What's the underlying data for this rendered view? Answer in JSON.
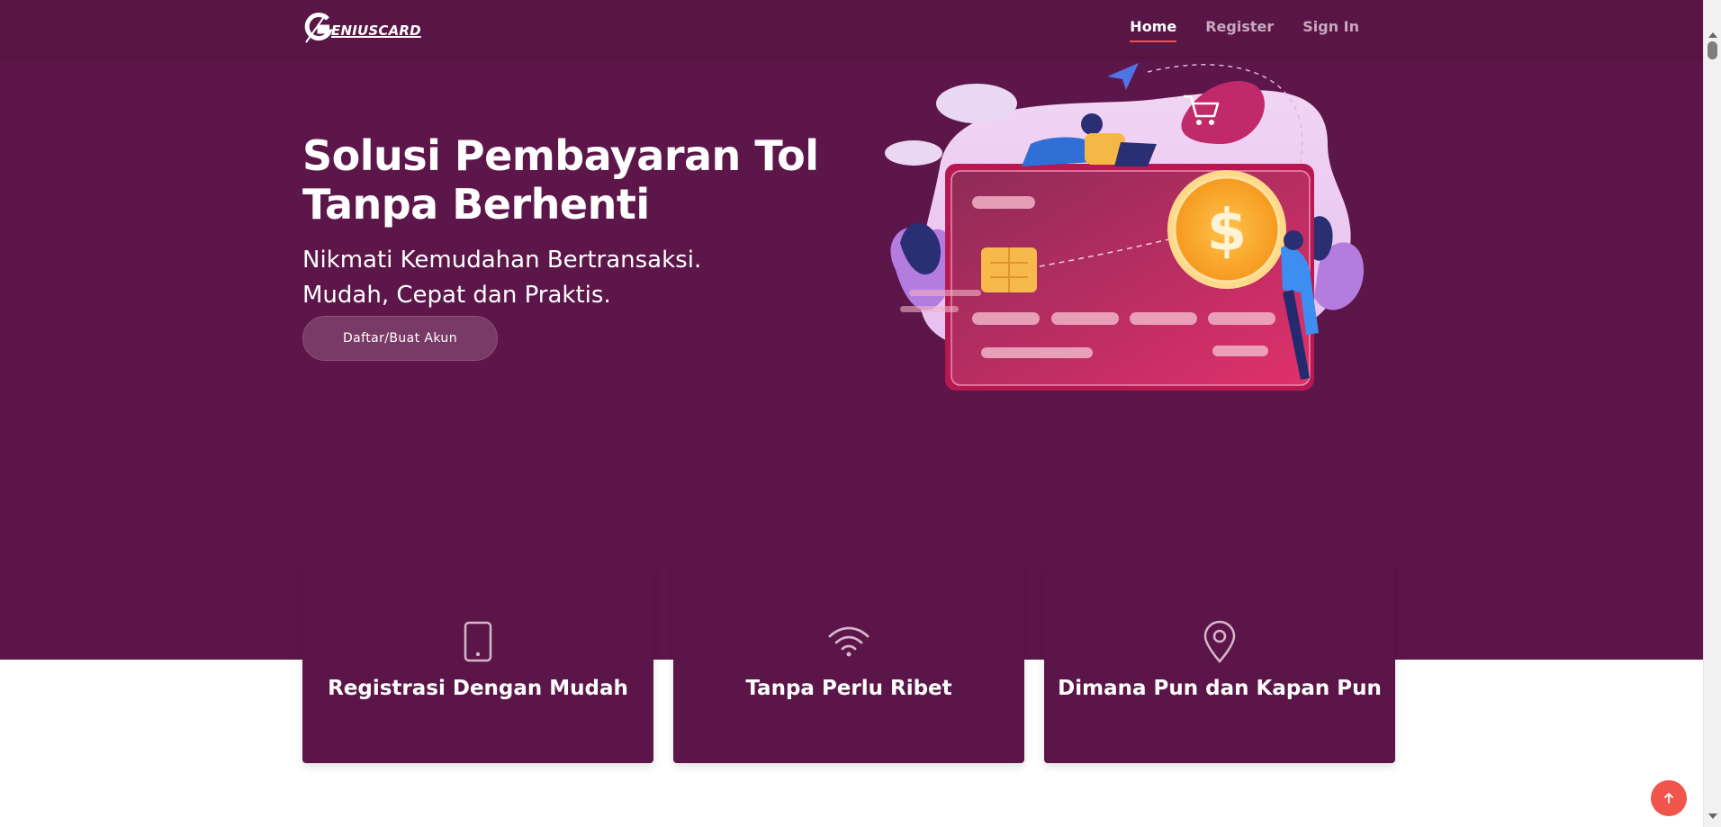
{
  "brand": {
    "logo_text": "ENIUSCARD",
    "logo_letter": "G"
  },
  "nav": {
    "items": [
      "Home",
      "Register",
      "Sign In"
    ],
    "active": "Home"
  },
  "hero": {
    "title": "Solusi Pembayaran Tol Tanpa Berhenti",
    "subtitle_line1": "Nikmati Kemudahan Bertransaksi.",
    "subtitle_line2": "Mudah, Cepat dan Praktis.",
    "cta_label": "Daftar/Buat Akun"
  },
  "features": [
    {
      "icon": "smartphone-icon",
      "title": "Registrasi Dengan Mudah"
    },
    {
      "icon": "wifi-icon",
      "title": "Tanpa Perlu Ribet"
    },
    {
      "icon": "map-pin-icon",
      "title": "Dimana Pun dan Kapan Pun"
    }
  ],
  "colors": {
    "hero_bg": "#5d1649",
    "accent": "#f0544a",
    "card_bg": "#5c1548"
  }
}
